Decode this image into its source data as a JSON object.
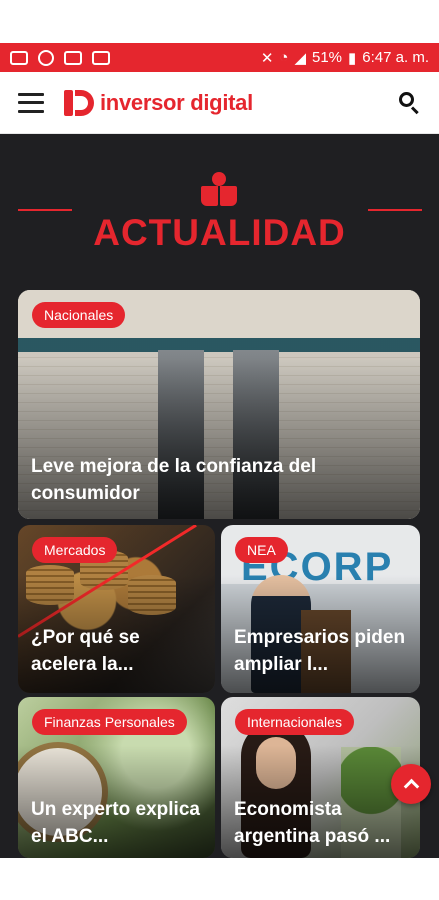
{
  "status_bar": {
    "battery": "51%",
    "time": "6:47 a. m.",
    "icons": [
      "message-icon",
      "whatsapp-icon",
      "activity-icon",
      "laptop-icon",
      "mute-icon",
      "wifi-icon",
      "signal-icon",
      "battery-icon"
    ]
  },
  "header": {
    "brand": "inversor digital",
    "menu_icon": "hamburger-icon",
    "search_icon": "search-icon"
  },
  "section": {
    "title": "ACTUALIDAD",
    "icon": "reader-book-icon"
  },
  "cards": [
    {
      "tag": "Nacionales",
      "headline": "Leve mejora de la confianza del consumidor"
    },
    {
      "tag": "Mercados",
      "headline": "¿Por qué se acelera la..."
    },
    {
      "tag": "NEA",
      "headline": "Empresarios piden ampliar l..."
    },
    {
      "tag": "Finanzas Personales",
      "headline": "Un experto explica el ABC..."
    },
    {
      "tag": "Internacionales",
      "headline": "Economista argentina pasó ..."
    }
  ],
  "colors": {
    "accent": "#e5262e",
    "content_bg": "#1f1f22",
    "header_bg": "#ffffff"
  },
  "fab": {
    "icon": "chevron-up-icon"
  }
}
